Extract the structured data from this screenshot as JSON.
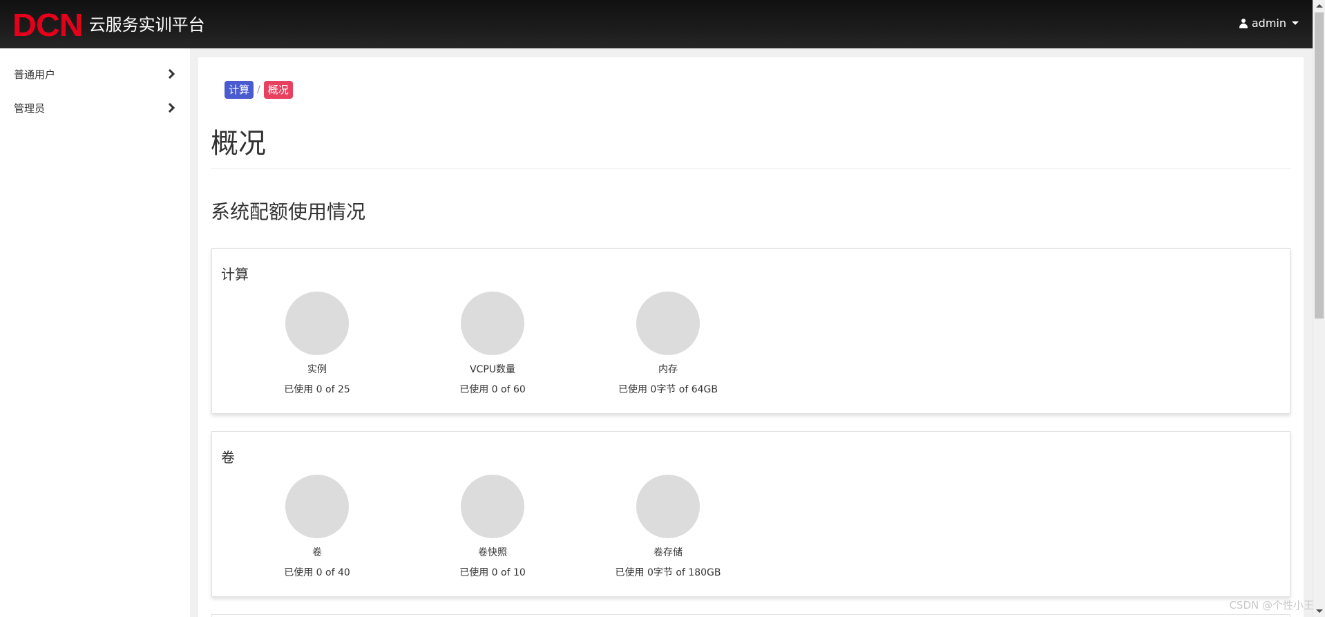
{
  "header": {
    "logo_text": "DCN",
    "title": "云服务实训平台",
    "user_label": "admin",
    "logo_color": "#e4001b"
  },
  "sidebar": {
    "items": [
      {
        "label": "普通用户"
      },
      {
        "label": "管理员"
      }
    ]
  },
  "breadcrumb": {
    "items": [
      {
        "label": "计算",
        "color": "#4a5bd0"
      },
      {
        "label": "概况",
        "color": "#e8415f"
      }
    ],
    "separator": "/"
  },
  "main": {
    "page_title": "概况",
    "section_title": "系统配额使用情况",
    "panels": [
      {
        "title": "计算",
        "stats": [
          {
            "label": "实例",
            "usage": "已使用 0 of 25"
          },
          {
            "label": "VCPU数量",
            "usage": "已使用 0 of 60"
          },
          {
            "label": "内存",
            "usage": "已使用 0字节 of 64GB"
          }
        ]
      },
      {
        "title": "卷",
        "stats": [
          {
            "label": "卷",
            "usage": "已使用 0 of 40"
          },
          {
            "label": "卷快照",
            "usage": "已使用 0 of 10"
          },
          {
            "label": "卷存储",
            "usage": "已使用 0字节 of 180GB"
          }
        ]
      }
    ]
  },
  "watermark": "CSDN @个性小王"
}
